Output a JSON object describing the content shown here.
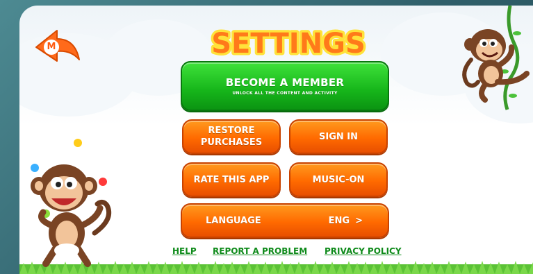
{
  "screen": {
    "title": "SETTINGS"
  },
  "member": {
    "label": "BECOME A MEMBER",
    "sublabel": "UNLOCK ALL THE CONTENT AND ACTIVITY"
  },
  "buttons": {
    "restore_line1": "RESTORE",
    "restore_line2": "PURCHASES",
    "sign_in": "SIGN IN",
    "rate": "RATE THIS APP",
    "music": "MUSIC-ON",
    "language_label": "LANGUAGE",
    "language_value": "ENG",
    "language_chevron": ">"
  },
  "links": {
    "help": "HELP",
    "report": "REPORT A PROBLEM",
    "privacy": "PRIVACY POLICY"
  },
  "back": {
    "badge_letter": "M"
  },
  "icons": {
    "back": "back-arrow-icon",
    "chevron": "chevron-right-icon"
  },
  "colors": {
    "orange": "#ff6a00",
    "green": "#16b51a",
    "title_fill": "#ff7a1a",
    "link": "#0e8a1a"
  }
}
